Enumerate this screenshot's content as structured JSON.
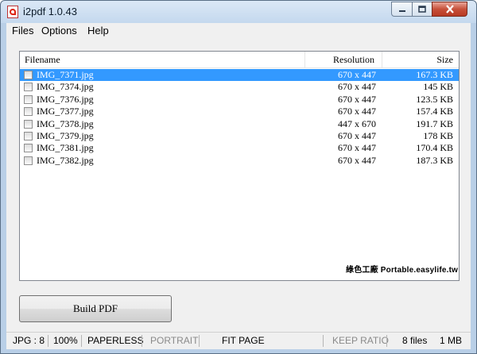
{
  "window": {
    "title": "i2pdf 1.0.43"
  },
  "menu": {
    "files": "Files",
    "options": "Options",
    "help": "Help"
  },
  "table": {
    "headers": {
      "filename": "Filename",
      "resolution": "Resolution",
      "size": "Size"
    },
    "rows": [
      {
        "name": "IMG_7371.jpg",
        "resolution": "670 x 447",
        "size": "167.3 KB",
        "selected": true
      },
      {
        "name": "IMG_7374.jpg",
        "resolution": "670 x 447",
        "size": "145 KB",
        "selected": false
      },
      {
        "name": "IMG_7376.jpg",
        "resolution": "670 x 447",
        "size": "123.5 KB",
        "selected": false
      },
      {
        "name": "IMG_7377.jpg",
        "resolution": "670 x 447",
        "size": "157.4 KB",
        "selected": false
      },
      {
        "name": "IMG_7378.jpg",
        "resolution": "447 x 670",
        "size": "191.7 KB",
        "selected": false
      },
      {
        "name": "IMG_7379.jpg",
        "resolution": "670 x 447",
        "size": "178 KB",
        "selected": false
      },
      {
        "name": "IMG_7381.jpg",
        "resolution": "670 x 447",
        "size": "170.4 KB",
        "selected": false
      },
      {
        "name": "IMG_7382.jpg",
        "resolution": "670 x 447",
        "size": "187.3 KB",
        "selected": false
      }
    ],
    "selection_color": "#3399ff"
  },
  "watermark": "綠色工廠 Portable.easylife.tw",
  "build_button": "Build PDF",
  "status": {
    "format": "JPG : 8",
    "zoom": "100%",
    "paper": "PAPERLESS",
    "orientation": "PORTRAIT",
    "fit": "FIT PAGE",
    "keep_ratio": "KEEP RATIO",
    "files": "8 files",
    "total": "1 MB"
  },
  "icons": {
    "app": "pdf-app-icon",
    "minimize": "minimize-icon",
    "maximize": "maximize-icon",
    "close": "close-icon"
  }
}
